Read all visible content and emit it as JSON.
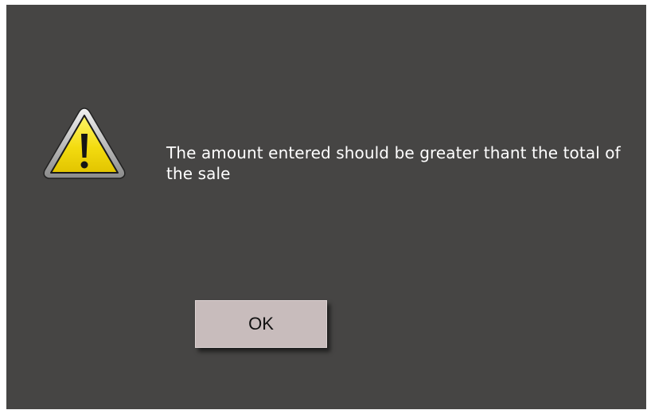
{
  "dialog": {
    "message": "The amount entered should be greater thant the total of the sale",
    "icon": "warning-triangle-icon",
    "ok_label": "OK"
  },
  "colors": {
    "background": "#464544",
    "text": "#ffffff",
    "button": "#c8bcbc",
    "icon_fill": "#f5e21a"
  }
}
